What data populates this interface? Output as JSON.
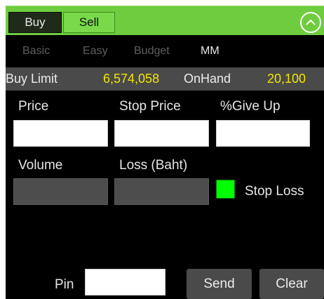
{
  "order_panel": {
    "buy_label": "Buy",
    "sell_label": "Sell",
    "colors": {
      "header_green": "#6fcc3f",
      "value_yellow": "#f2e600",
      "stop_loss_green": "#00ff00"
    },
    "collapse_icon": "chevron-up-circle-icon"
  },
  "tabs": [
    {
      "label": "Basic",
      "active": false
    },
    {
      "label": "Easy",
      "active": false
    },
    {
      "label": "Budget",
      "active": false
    },
    {
      "label": "MM",
      "active": true
    }
  ],
  "account": {
    "buy_limit_label": "Buy Limit",
    "buy_limit_value": "6,574,058",
    "onhand_label": "OnHand",
    "onhand_value": "20,100"
  },
  "fields": {
    "price_label": "Price",
    "stop_price_label": "Stop Price",
    "give_up_label": "%Give Up",
    "volume_label": "Volume",
    "loss_label": "Loss (Baht)",
    "stop_loss_label": "Stop Loss",
    "stop_loss_checked": true,
    "pin_label": "Pin"
  },
  "actions": {
    "send_label": "Send",
    "clear_label": "Clear"
  }
}
